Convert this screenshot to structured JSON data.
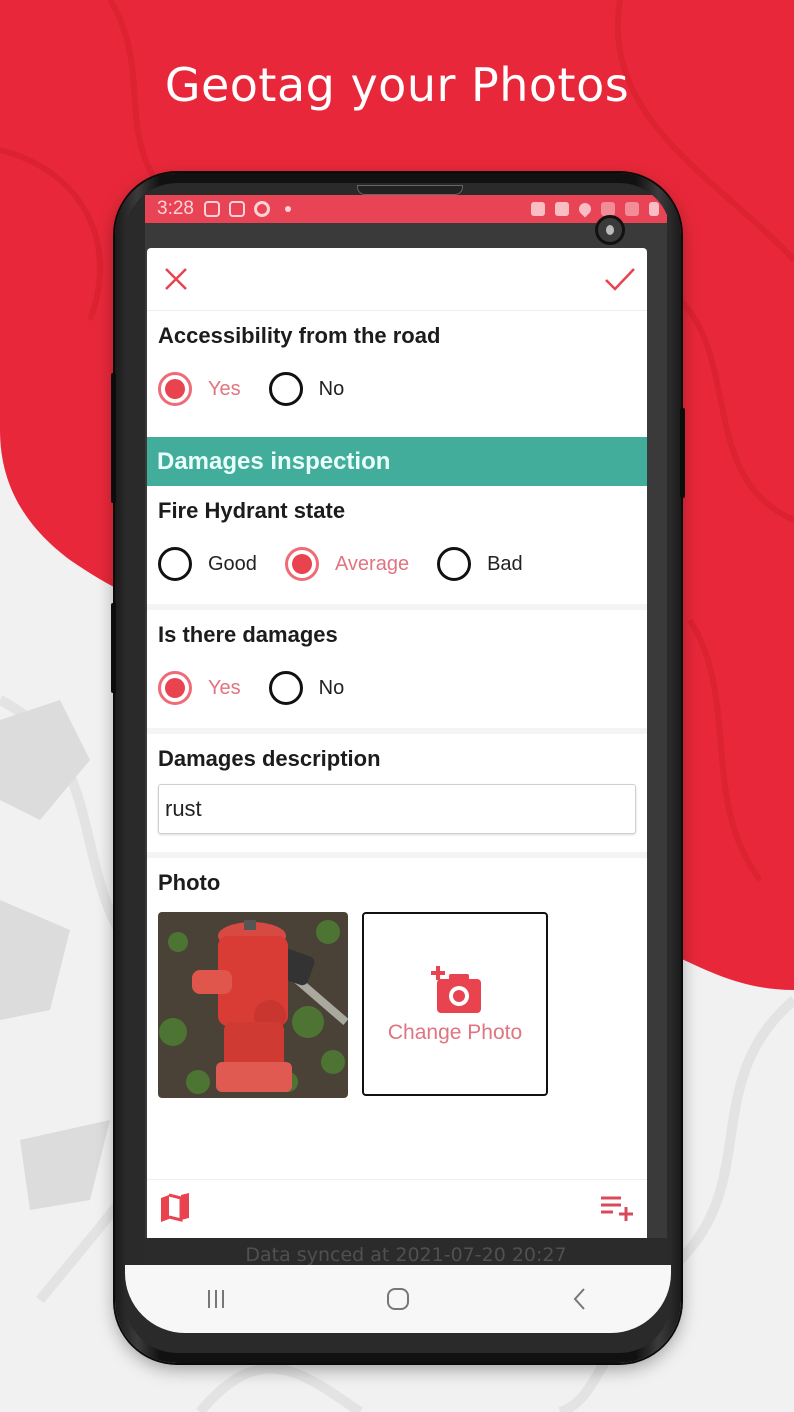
{
  "promo": {
    "title": "Geotag your Photos"
  },
  "colors": {
    "brand_red": "#E8283A",
    "status_bar": "#E84455",
    "accent_radio": "#e8434f",
    "section_header": "#43ad9c",
    "map_grey": "#f0f0f0"
  },
  "statusbar": {
    "time": "3:28",
    "left_icons": [
      "instagram-icon",
      "instagram-icon",
      "spiral-app-icon",
      "notification-dot-icon"
    ],
    "right_icons": [
      "alarm-icon",
      "mute-icon",
      "location-icon",
      "wifi-icon",
      "signal-icon",
      "battery-icon"
    ]
  },
  "form": {
    "toolbar": {
      "close_icon": "close-icon",
      "save_icon": "check-icon"
    },
    "accessibility": {
      "label": "Accessibility from the road",
      "options": [
        {
          "label": "Yes",
          "checked": true
        },
        {
          "label": "No",
          "checked": false
        }
      ]
    },
    "section_header": "Damages inspection",
    "hydrant_state": {
      "label": "Fire Hydrant state",
      "options": [
        {
          "label": "Good",
          "checked": false
        },
        {
          "label": "Average",
          "checked": true
        },
        {
          "label": "Bad",
          "checked": false
        }
      ]
    },
    "is_damaged": {
      "label": "Is there damages",
      "options": [
        {
          "label": "Yes",
          "checked": true
        },
        {
          "label": "No",
          "checked": false
        }
      ]
    },
    "damages_description": {
      "label": "Damages description",
      "value": "rust"
    },
    "photo": {
      "label": "Photo",
      "thumbnail_alt": "fire hydrant photo",
      "change_label": "Change Photo"
    },
    "bottombar": {
      "left_icon": "map-icon",
      "right_icon": "playlist-add-icon"
    }
  },
  "sync": {
    "text": "Data synced at 2021-07-20 20:27"
  },
  "navbar": {
    "recents_icon": "recents-icon",
    "home_icon": "home-icon",
    "back_icon": "back-icon"
  }
}
